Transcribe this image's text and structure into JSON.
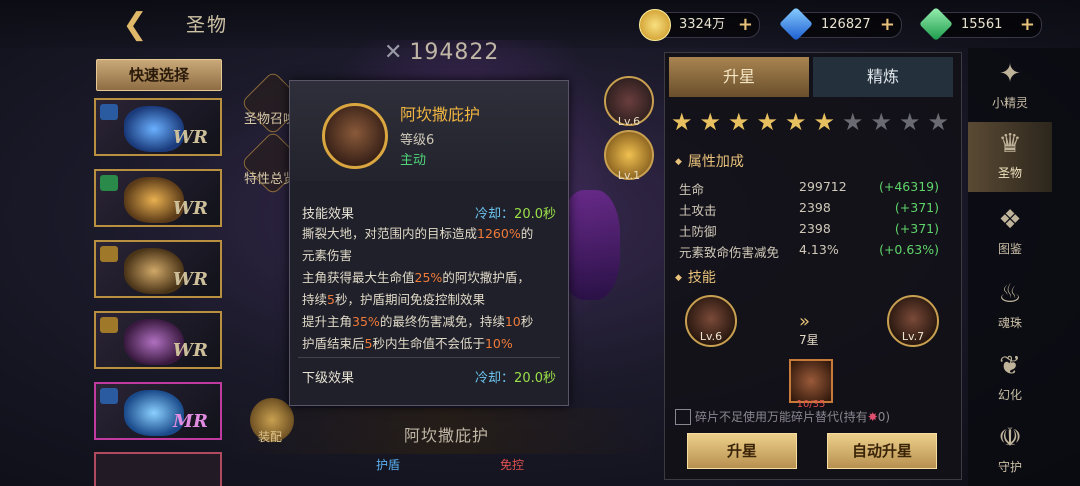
{
  "header": {
    "back_icon": "chevron-left-icon",
    "title": "圣物"
  },
  "resources": [
    {
      "name": "gold",
      "value": "3324万",
      "color": "#e8c040"
    },
    {
      "name": "blue-gem",
      "value": "126827",
      "color": "#3aa0ff"
    },
    {
      "name": "green-gem",
      "value": "15561",
      "color": "#3ad07a"
    }
  ],
  "left": {
    "quick_select": "快速选择",
    "cards": [
      {
        "rank": "WR",
        "color": "#3a7ad8"
      },
      {
        "rank": "WR",
        "color": "#c89a3a"
      },
      {
        "rank": "WR",
        "color": "#b08a4a"
      },
      {
        "rank": "WR",
        "color": "#8a5a9a"
      },
      {
        "rank": "MR",
        "color": "#4aa0e8"
      }
    ]
  },
  "center": {
    "power": "194822",
    "side_buttons": [
      "圣物召唤",
      "特性总览"
    ],
    "right_icons": [
      "Lv.6",
      "Lv.1"
    ],
    "equip_label": "装配",
    "relic_name": "阿坎撒庇护",
    "bottom_tags": [
      "护盾",
      "免控"
    ]
  },
  "tooltip": {
    "name": "阿坎撒庇护",
    "level": "等级6",
    "type": "主动",
    "current": {
      "title": "技能效果",
      "cooldown_label": "冷却：",
      "cooldown_value": "20.0秒",
      "lines": [
        [
          {
            "t": "撕裂大地，对范围内的目标造成"
          },
          {
            "t": "1260%",
            "h": 1
          },
          {
            "t": "的"
          }
        ],
        [
          {
            "t": "元素伤害"
          }
        ],
        [
          {
            "t": "主角获得最大生命值"
          },
          {
            "t": "25%",
            "h": 1
          },
          {
            "t": "的阿坎撒护盾，"
          }
        ],
        [
          {
            "t": "持续"
          },
          {
            "t": "5",
            "h": 1
          },
          {
            "t": "秒，护盾期间免疫控制效果"
          }
        ],
        [
          {
            "t": "提升主角"
          },
          {
            "t": "35%",
            "h": 1
          },
          {
            "t": "的最终伤害减免，持续"
          },
          {
            "t": "10",
            "h": 1
          },
          {
            "t": "秒"
          }
        ],
        [
          {
            "t": "护盾结束后"
          },
          {
            "t": "5",
            "h": 1
          },
          {
            "t": "秒内生命值不会低于"
          },
          {
            "t": "10%",
            "h": 1
          }
        ]
      ]
    },
    "next": {
      "title": "下级效果",
      "cooldown_label": "冷却：",
      "cooldown_value": "20.0秒"
    }
  },
  "panel": {
    "tabs": [
      "升星",
      "精炼"
    ],
    "stars_filled": 6,
    "stars_total": 10,
    "attr_title": "属性加成",
    "attributes": [
      {
        "name": "生命",
        "value": "299712",
        "bonus": "(+46319)"
      },
      {
        "name": "土攻击",
        "value": "2398",
        "bonus": "(+371)"
      },
      {
        "name": "土防御",
        "value": "2398",
        "bonus": "(+371)"
      },
      {
        "name": "元素致命伤害减免",
        "value": "4.13%",
        "bonus": "(+0.63%)"
      }
    ],
    "skill_title": "技能",
    "skill_from": "Lv.6",
    "skill_to": "Lv.7",
    "star_req": "7星",
    "shard_count": "10/35",
    "checkbox_label": "碎片不足使用万能碎片替代(持有",
    "checkbox_count": "0)",
    "btn_upgrade": "升星",
    "btn_auto": "自动升星"
  },
  "nav": [
    {
      "label": "小精灵",
      "icon": "fairy-icon"
    },
    {
      "label": "圣物",
      "icon": "relic-icon"
    },
    {
      "label": "图鉴",
      "icon": "codex-icon"
    },
    {
      "label": "魂珠",
      "icon": "soul-orb-icon"
    },
    {
      "label": "幻化",
      "icon": "transform-icon"
    },
    {
      "label": "守护",
      "icon": "guardian-icon"
    }
  ]
}
